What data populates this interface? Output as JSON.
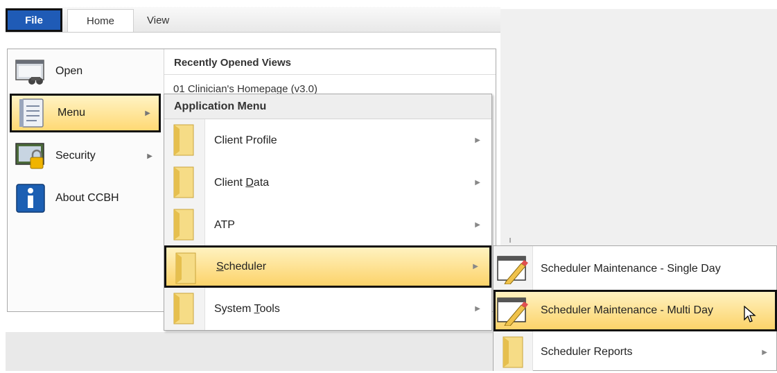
{
  "ribbon": {
    "tabs": [
      {
        "label": "File"
      },
      {
        "label": "Home"
      },
      {
        "label": "View"
      }
    ]
  },
  "left_nav": {
    "items": [
      {
        "label": "Open",
        "icon": "open-view-icon"
      },
      {
        "label": "Menu",
        "icon": "menu-notebook-icon"
      },
      {
        "label": "Security",
        "icon": "security-lock-icon"
      },
      {
        "label": "About CCBH",
        "icon": "info-icon"
      }
    ]
  },
  "recent": {
    "title": "Recently Opened Views",
    "items": [
      "01 Clinician's Homepage (v3.0)"
    ]
  },
  "app_menu": {
    "title": "Application Menu",
    "items": [
      {
        "label": "Client Profile",
        "pre": "Client Profile",
        "acc": "",
        "post": ""
      },
      {
        "label": "Client Data",
        "pre": "Client ",
        "acc": "D",
        "post": "ata"
      },
      {
        "label": "ATP",
        "pre": "ATP",
        "acc": "",
        "post": ""
      },
      {
        "label": "Scheduler",
        "pre": "",
        "acc": "S",
        "post": "cheduler"
      },
      {
        "label": "System Tools",
        "pre": "System ",
        "acc": "T",
        "post": "ools"
      }
    ]
  },
  "scheduler_menu": {
    "items": [
      {
        "label": "Scheduler Maintenance - Single Day"
      },
      {
        "label": "Scheduler Maintenance - Multi Day"
      },
      {
        "label": "Scheduler Reports"
      }
    ]
  },
  "colors": {
    "file_tab": "#1f5bb6",
    "highlight_top": "#fff2c0",
    "highlight_bottom": "#fcd36a",
    "outline": "#101010"
  }
}
